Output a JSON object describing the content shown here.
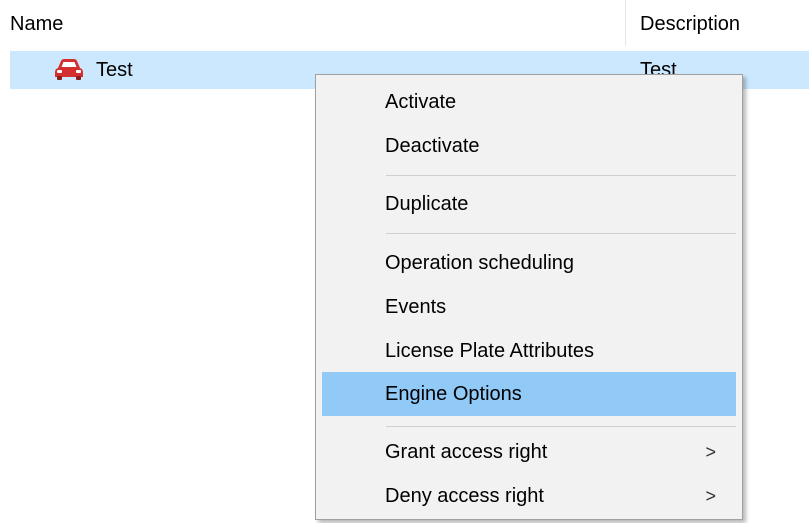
{
  "columns": {
    "name": "Name",
    "description": "Description"
  },
  "row": {
    "name": "Test",
    "description": "Test",
    "icon": "car-icon",
    "icon_color": "#d32f2f",
    "selected_color": "#cce8ff"
  },
  "menu": {
    "highlight_color": "#91c9f7",
    "items": [
      {
        "label": "Activate"
      },
      {
        "label": "Deactivate"
      },
      {
        "label": "Duplicate"
      },
      {
        "label": "Operation scheduling"
      },
      {
        "label": "Events"
      },
      {
        "label": "License Plate Attributes"
      },
      {
        "label": "Engine Options"
      },
      {
        "label": "Grant access right",
        "submenu_arrow": ">"
      },
      {
        "label": "Deny access right",
        "submenu_arrow": ">"
      }
    ]
  }
}
